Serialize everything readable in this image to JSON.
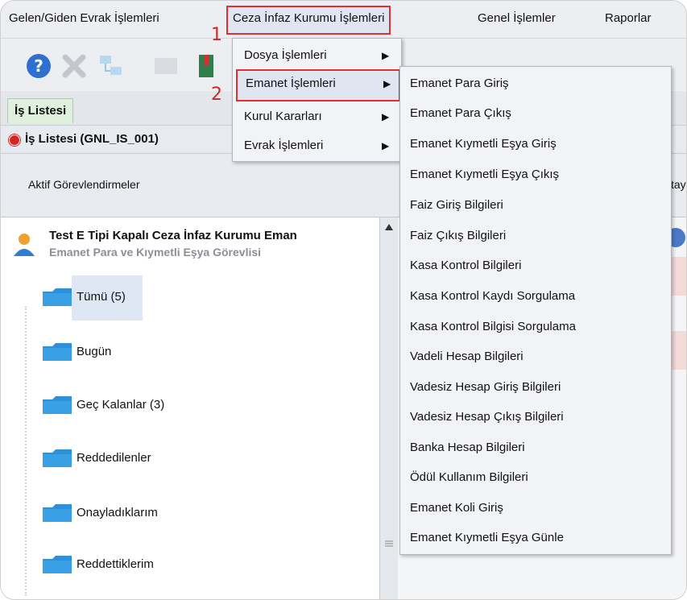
{
  "menubar": {
    "items": [
      {
        "label": "Gelen/Giden Evrak İşlemleri"
      },
      {
        "label": "Ceza İnfaz Kurumu İşlemleri"
      },
      {
        "label": "Genel İşlemler"
      },
      {
        "label": "Raporlar"
      }
    ]
  },
  "annotations": {
    "step1": "1",
    "step2": "2"
  },
  "toolbar": {
    "icons": [
      "help-icon",
      "delete-icon",
      "network-icon",
      "blank-icon",
      "book-icon"
    ]
  },
  "tabs": {
    "main": "İş Listesi",
    "sub": "İş Listesi (GNL_IS_001)"
  },
  "aktif": {
    "label": "Aktif Görevlendirmeler",
    "clipped_right": "tay"
  },
  "tree": {
    "title": "Test E Tipi Kapalı Ceza İnfaz Kurumu Eman",
    "subtitle": "Emanet Para ve Kıymetli Eşya Görevlisi",
    "nodes": [
      {
        "label": "Tümü (5)"
      },
      {
        "label": "Bugün"
      },
      {
        "label": "Geç Kalanlar (3)"
      },
      {
        "label": "Reddedilenler"
      },
      {
        "label": "Onayladıklarım"
      },
      {
        "label": "Reddettiklerim"
      }
    ]
  },
  "submenu1": {
    "items": [
      {
        "label": "Dosya İşlemleri"
      },
      {
        "label": "Emanet İşlemleri"
      },
      {
        "label": "Kurul Kararları"
      },
      {
        "label": "Evrak İşlemleri"
      }
    ]
  },
  "submenu2": {
    "items": [
      {
        "label": "Emanet Para Giriş"
      },
      {
        "label": "Emanet Para Çıkış"
      },
      {
        "label": "Emanet Kıymetli Eşya Giriş"
      },
      {
        "label": "Emanet Kıymetli Eşya Çıkış"
      },
      {
        "label": "Faiz Giriş Bilgileri"
      },
      {
        "label": "Faiz Çıkış Bilgileri"
      },
      {
        "label": "Kasa Kontrol Bilgileri"
      },
      {
        "label": "Kasa Kontrol Kaydı Sorgulama"
      },
      {
        "label": "Kasa Kontrol Bilgisi Sorgulama"
      },
      {
        "label": "Vadeli Hesap Bilgileri"
      },
      {
        "label": "Vadesiz Hesap Giriş Bilgileri"
      },
      {
        "label": "Vadesiz Hesap Çıkış Bilgileri"
      },
      {
        "label": "Banka Hesap Bilgileri"
      },
      {
        "label": "Ödül Kullanım Bilgileri"
      },
      {
        "label": "Emanet Koli Giriş"
      },
      {
        "label": "Emanet Kıymetli Eşya Günle"
      }
    ]
  },
  "colors": {
    "highlight_border": "#e03030",
    "tab_green": "#dff0dc"
  }
}
